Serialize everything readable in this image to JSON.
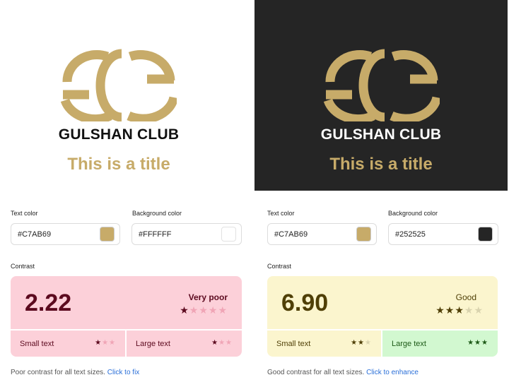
{
  "colors": {
    "gold": "#C7AB69",
    "dark": "#252525",
    "white": "#FFFFFF",
    "link": "#2a6fd8"
  },
  "panels": [
    {
      "brand": "GULSHAN CLUB",
      "title": "This is a title",
      "text_color_label": "Text color",
      "text_color_value": "#C7AB69",
      "bg_color_label": "Background color",
      "bg_color_value": "#FFFFFF",
      "contrast_label": "Contrast",
      "ratio": "2.22",
      "rating": "Very poor",
      "rating_stars": 1,
      "small_text_label": "Small text",
      "small_text_stars": 1,
      "large_text_label": "Large text",
      "large_text_stars": 1,
      "footer_text": "Poor contrast for all text sizes.",
      "footer_link": "Click to fix"
    },
    {
      "brand": "GULSHAN CLUB",
      "title": "This is a title",
      "text_color_label": "Text color",
      "text_color_value": "#C7AB69",
      "bg_color_label": "Background color",
      "bg_color_value": "#252525",
      "contrast_label": "Contrast",
      "ratio": "6.90",
      "rating": "Good",
      "rating_stars": 3,
      "small_text_label": "Small text",
      "small_text_stars": 2,
      "large_text_label": "Large text",
      "large_text_stars": 3,
      "footer_text": "Good contrast for all text sizes.",
      "footer_link": "Click to enhance"
    }
  ]
}
